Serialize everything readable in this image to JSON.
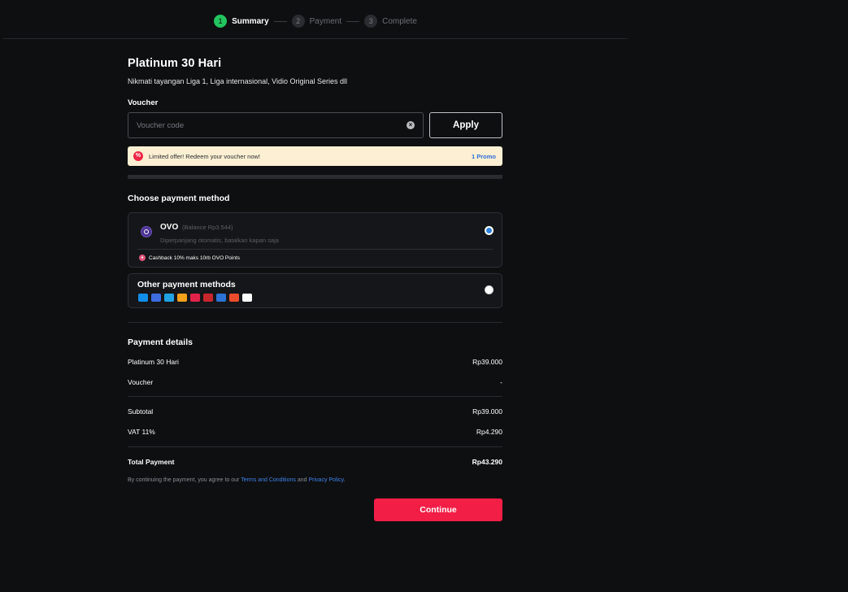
{
  "stepper": {
    "steps": [
      {
        "number": "1",
        "label": "Summary"
      },
      {
        "number": "2",
        "label": "Payment"
      },
      {
        "number": "3",
        "label": "Complete"
      }
    ]
  },
  "plan": {
    "title": "Platinum 30 Hari",
    "description": "Nikmati tayangan Liga 1, Liga internasional, Vidio Original Series dll"
  },
  "voucher": {
    "label": "Voucher",
    "placeholder": "Voucher code",
    "value": "",
    "apply_label": "Apply"
  },
  "promo": {
    "icon": "%",
    "text": "Limited offer! Redeem your voucher now!",
    "count": "1 Promo"
  },
  "payment_method": {
    "title": "Choose payment method",
    "ovo": {
      "name": "OVO",
      "balance": "(Balance Rp3.544)",
      "subtitle": "Diperpanjang otomatis, batalkan kapan saja",
      "cashback": "Cashback 10% maks 10rb OVO Points",
      "selected": true
    },
    "other": {
      "title": "Other payment methods",
      "selected": false,
      "icons": [
        {
          "name": "dana-icon",
          "color": "#118ee9"
        },
        {
          "name": "linkaja-icon",
          "color": "#3e6de0"
        },
        {
          "name": "gopay-icon",
          "color": "#1fa3e4"
        },
        {
          "name": "bca-icon",
          "color": "#f4a01a"
        },
        {
          "name": "telkomsel-icon",
          "color": "#e0234b"
        },
        {
          "name": "indosat-icon",
          "color": "#c8262c"
        },
        {
          "name": "kredivo-icon",
          "color": "#2b73d6"
        },
        {
          "name": "shopeepay-icon",
          "color": "#ee4d2d"
        },
        {
          "name": "qris-icon",
          "color": "#ffffff"
        }
      ]
    }
  },
  "payment_details": {
    "title": "Payment details",
    "items": [
      {
        "label": "Platinum 30 Hari",
        "value": "Rp39.000"
      },
      {
        "label": "Voucher",
        "value": "-"
      }
    ],
    "subtotal": {
      "label": "Subtotal",
      "value": "Rp39.000"
    },
    "vat": {
      "label": "VAT 11%",
      "value": "Rp4.290"
    },
    "total": {
      "label": "Total Payment",
      "value": "Rp43.290"
    }
  },
  "terms": {
    "prefix": "By continuing the payment, you agree to our",
    "terms_link": "Terms and Conditions",
    "and": "and",
    "privacy_link": "Privacy Policy",
    "suffix": "."
  },
  "continue_label": "Continue"
}
